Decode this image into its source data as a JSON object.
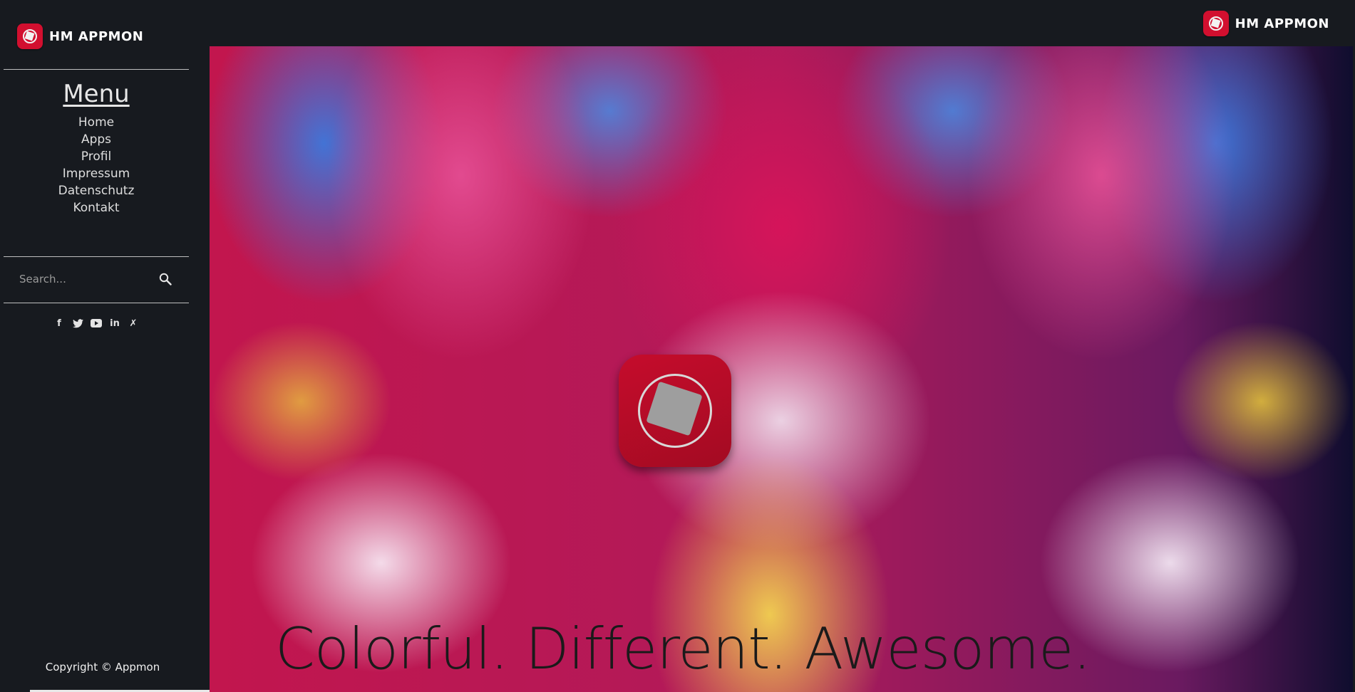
{
  "brand": {
    "name": "HM APPMON"
  },
  "sidebar": {
    "menu_title": "Menu",
    "items": [
      {
        "label": "Home"
      },
      {
        "label": "Apps"
      },
      {
        "label": "Profil"
      },
      {
        "label": "Impressum"
      },
      {
        "label": "Datenschutz"
      },
      {
        "label": "Kontakt"
      }
    ],
    "search": {
      "placeholder": "Search..."
    },
    "social": [
      {
        "icon": "facebook-icon",
        "glyph": "f"
      },
      {
        "icon": "twitter-icon",
        "glyph": "🐦"
      },
      {
        "icon": "youtube-icon",
        "glyph": "▶"
      },
      {
        "icon": "linkedin-icon",
        "glyph": "in"
      },
      {
        "icon": "xing-icon",
        "glyph": "✗"
      }
    ],
    "copyright": "Copyright © Appmon"
  },
  "hero": {
    "tagline": "Colorful. Different. Awesome."
  },
  "colors": {
    "background": "#171a1f",
    "brand_red": "#d20f2f"
  }
}
